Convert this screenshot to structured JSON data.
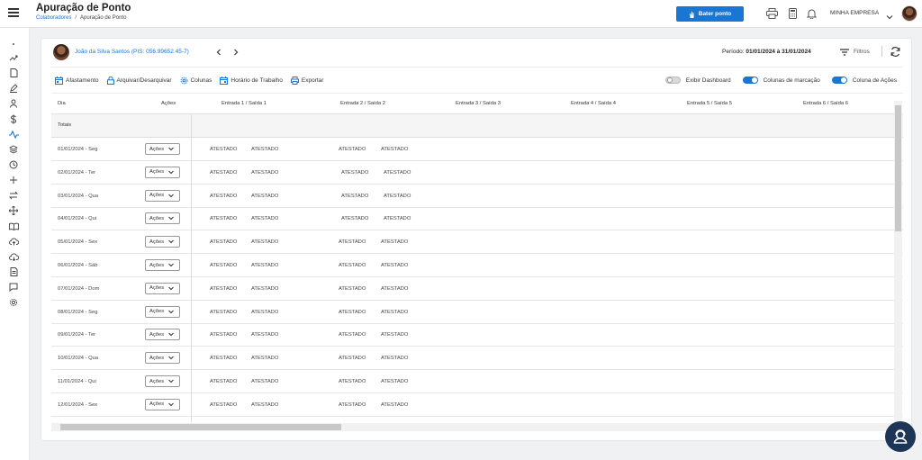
{
  "header": {
    "title": "Apuração de Ponto",
    "breadcrumb": {
      "link": "Colaboradores",
      "current": "Apuração de Ponto"
    },
    "punch_button": "Bater ponto",
    "company": "MINHA EMPRESA"
  },
  "sidebar": {
    "icons": [
      "dot-icon",
      "trend-icon",
      "document-icon",
      "edit-icon",
      "person-icon",
      "dollar-icon",
      "pulse-icon",
      "layers-icon",
      "clock-icon",
      "plus-icon",
      "transfer-icon",
      "move-icon",
      "book-icon",
      "cloud-upload-icon",
      "cloud-download-icon",
      "report-icon",
      "chat-icon",
      "settings-icon"
    ]
  },
  "employee": {
    "name": "João da Silva Santos (PIS: 056.99652.45-7)"
  },
  "period": {
    "label": "Período:",
    "value": "01/01/2024 à 31/01/2024"
  },
  "filters_label": "Filtros",
  "toolbar": {
    "items": [
      {
        "label": "Afastamento",
        "icon": "calendar-icon"
      },
      {
        "label": "Arquivar/Desarquivar",
        "icon": "lock-icon"
      },
      {
        "label": "Colunas",
        "icon": "gear-icon"
      },
      {
        "label": "Horário de Trabalho",
        "icon": "calendar-icon"
      },
      {
        "label": "Exportar",
        "icon": "print-icon"
      }
    ]
  },
  "toggles": [
    {
      "label": "Exibir Dashboard",
      "on": false
    },
    {
      "label": "Colunas de marcação",
      "on": true
    },
    {
      "label": "Coluna de Ações",
      "on": true
    }
  ],
  "table": {
    "columns": [
      "Dia",
      "Ações",
      "Entrada 1 / Saída 1",
      "Entrada 2 / Saída 2",
      "Entrada 3 / Saída 3",
      "Entrada 4 / Saída 4",
      "Entrada 5 / Saída 5",
      "Entrada 6 / Saída 6"
    ],
    "totals_label": "Totais",
    "actions_label": "Ações",
    "cell_value": "ATESTADO",
    "rows": [
      "01/01/2024 - Seg",
      "02/01/2024 - Ter",
      "03/01/2024 - Qua",
      "04/01/2024 - Qui",
      "05/01/2024 - Sex",
      "06/01/2024 - Sáb",
      "07/01/2024 - Dom",
      "08/01/2024 - Seg",
      "09/01/2024 - Ter",
      "10/01/2024 - Qua",
      "11/01/2024 - Qui",
      "12/01/2024 - Sex",
      ""
    ]
  },
  "colors": {
    "primary": "#1976d2",
    "help_button": "#1d3557"
  }
}
